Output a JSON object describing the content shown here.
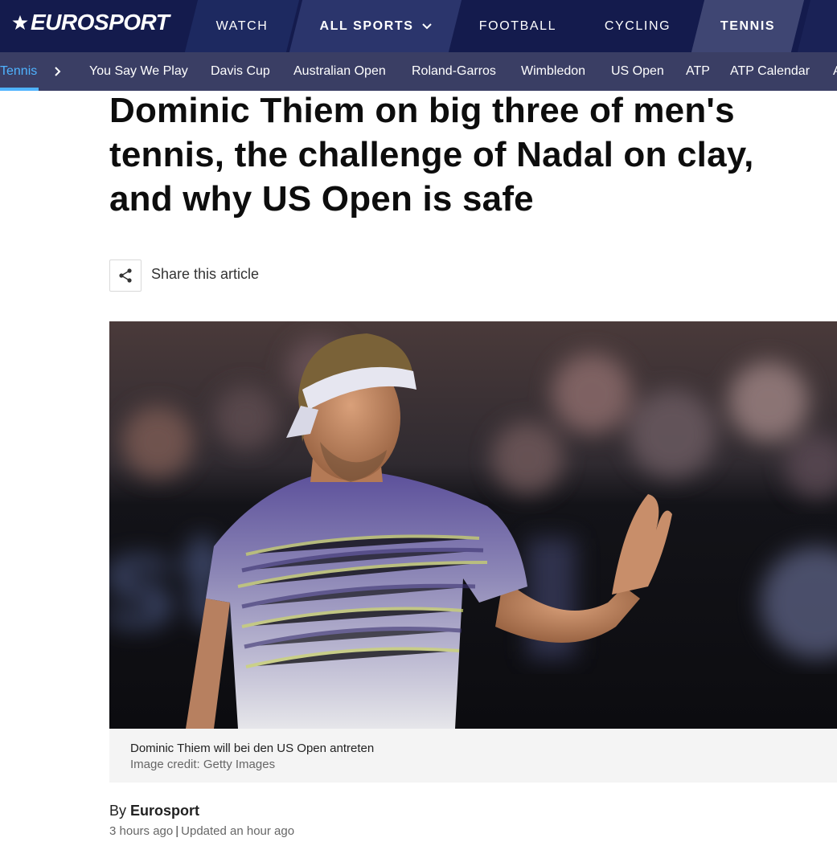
{
  "brand": {
    "logo_text": "EUROSPORT"
  },
  "topnav": {
    "tabs": [
      {
        "label": "WATCH"
      },
      {
        "label": "ALL SPORTS"
      },
      {
        "label": "FOOTBALL"
      },
      {
        "label": "CYCLING"
      },
      {
        "label": "TENNIS"
      }
    ]
  },
  "subnav": {
    "items": [
      {
        "label": "Tennis"
      },
      {
        "label": "You Say We Play"
      },
      {
        "label": "Davis Cup"
      },
      {
        "label": "Australian Open"
      },
      {
        "label": "Roland-Garros"
      },
      {
        "label": "Wimbledon"
      },
      {
        "label": "US Open"
      },
      {
        "label": "ATP"
      },
      {
        "label": "ATP Calendar"
      },
      {
        "label": "A"
      }
    ]
  },
  "article": {
    "headline": "Dominic Thiem on big three of men's tennis, the challenge of Nadal on clay, and why US Open is safe",
    "share_label": "Share this article",
    "image_caption": "Dominic Thiem will bei den US Open antreten",
    "image_credit": "Image credit: Getty Images",
    "byline_prefix": "By",
    "byline_author": "Eurosport",
    "published": "3 hours ago",
    "separator": "|",
    "updated": "Updated an hour ago"
  },
  "colors": {
    "nav_bg": "#141b4d",
    "subnav_bg": "#3a3e64",
    "active_accent": "#4fb3ff"
  },
  "icons": [
    "eurosport-star-icon",
    "chevron-down-icon",
    "chevron-right-icon",
    "share-icon"
  ]
}
